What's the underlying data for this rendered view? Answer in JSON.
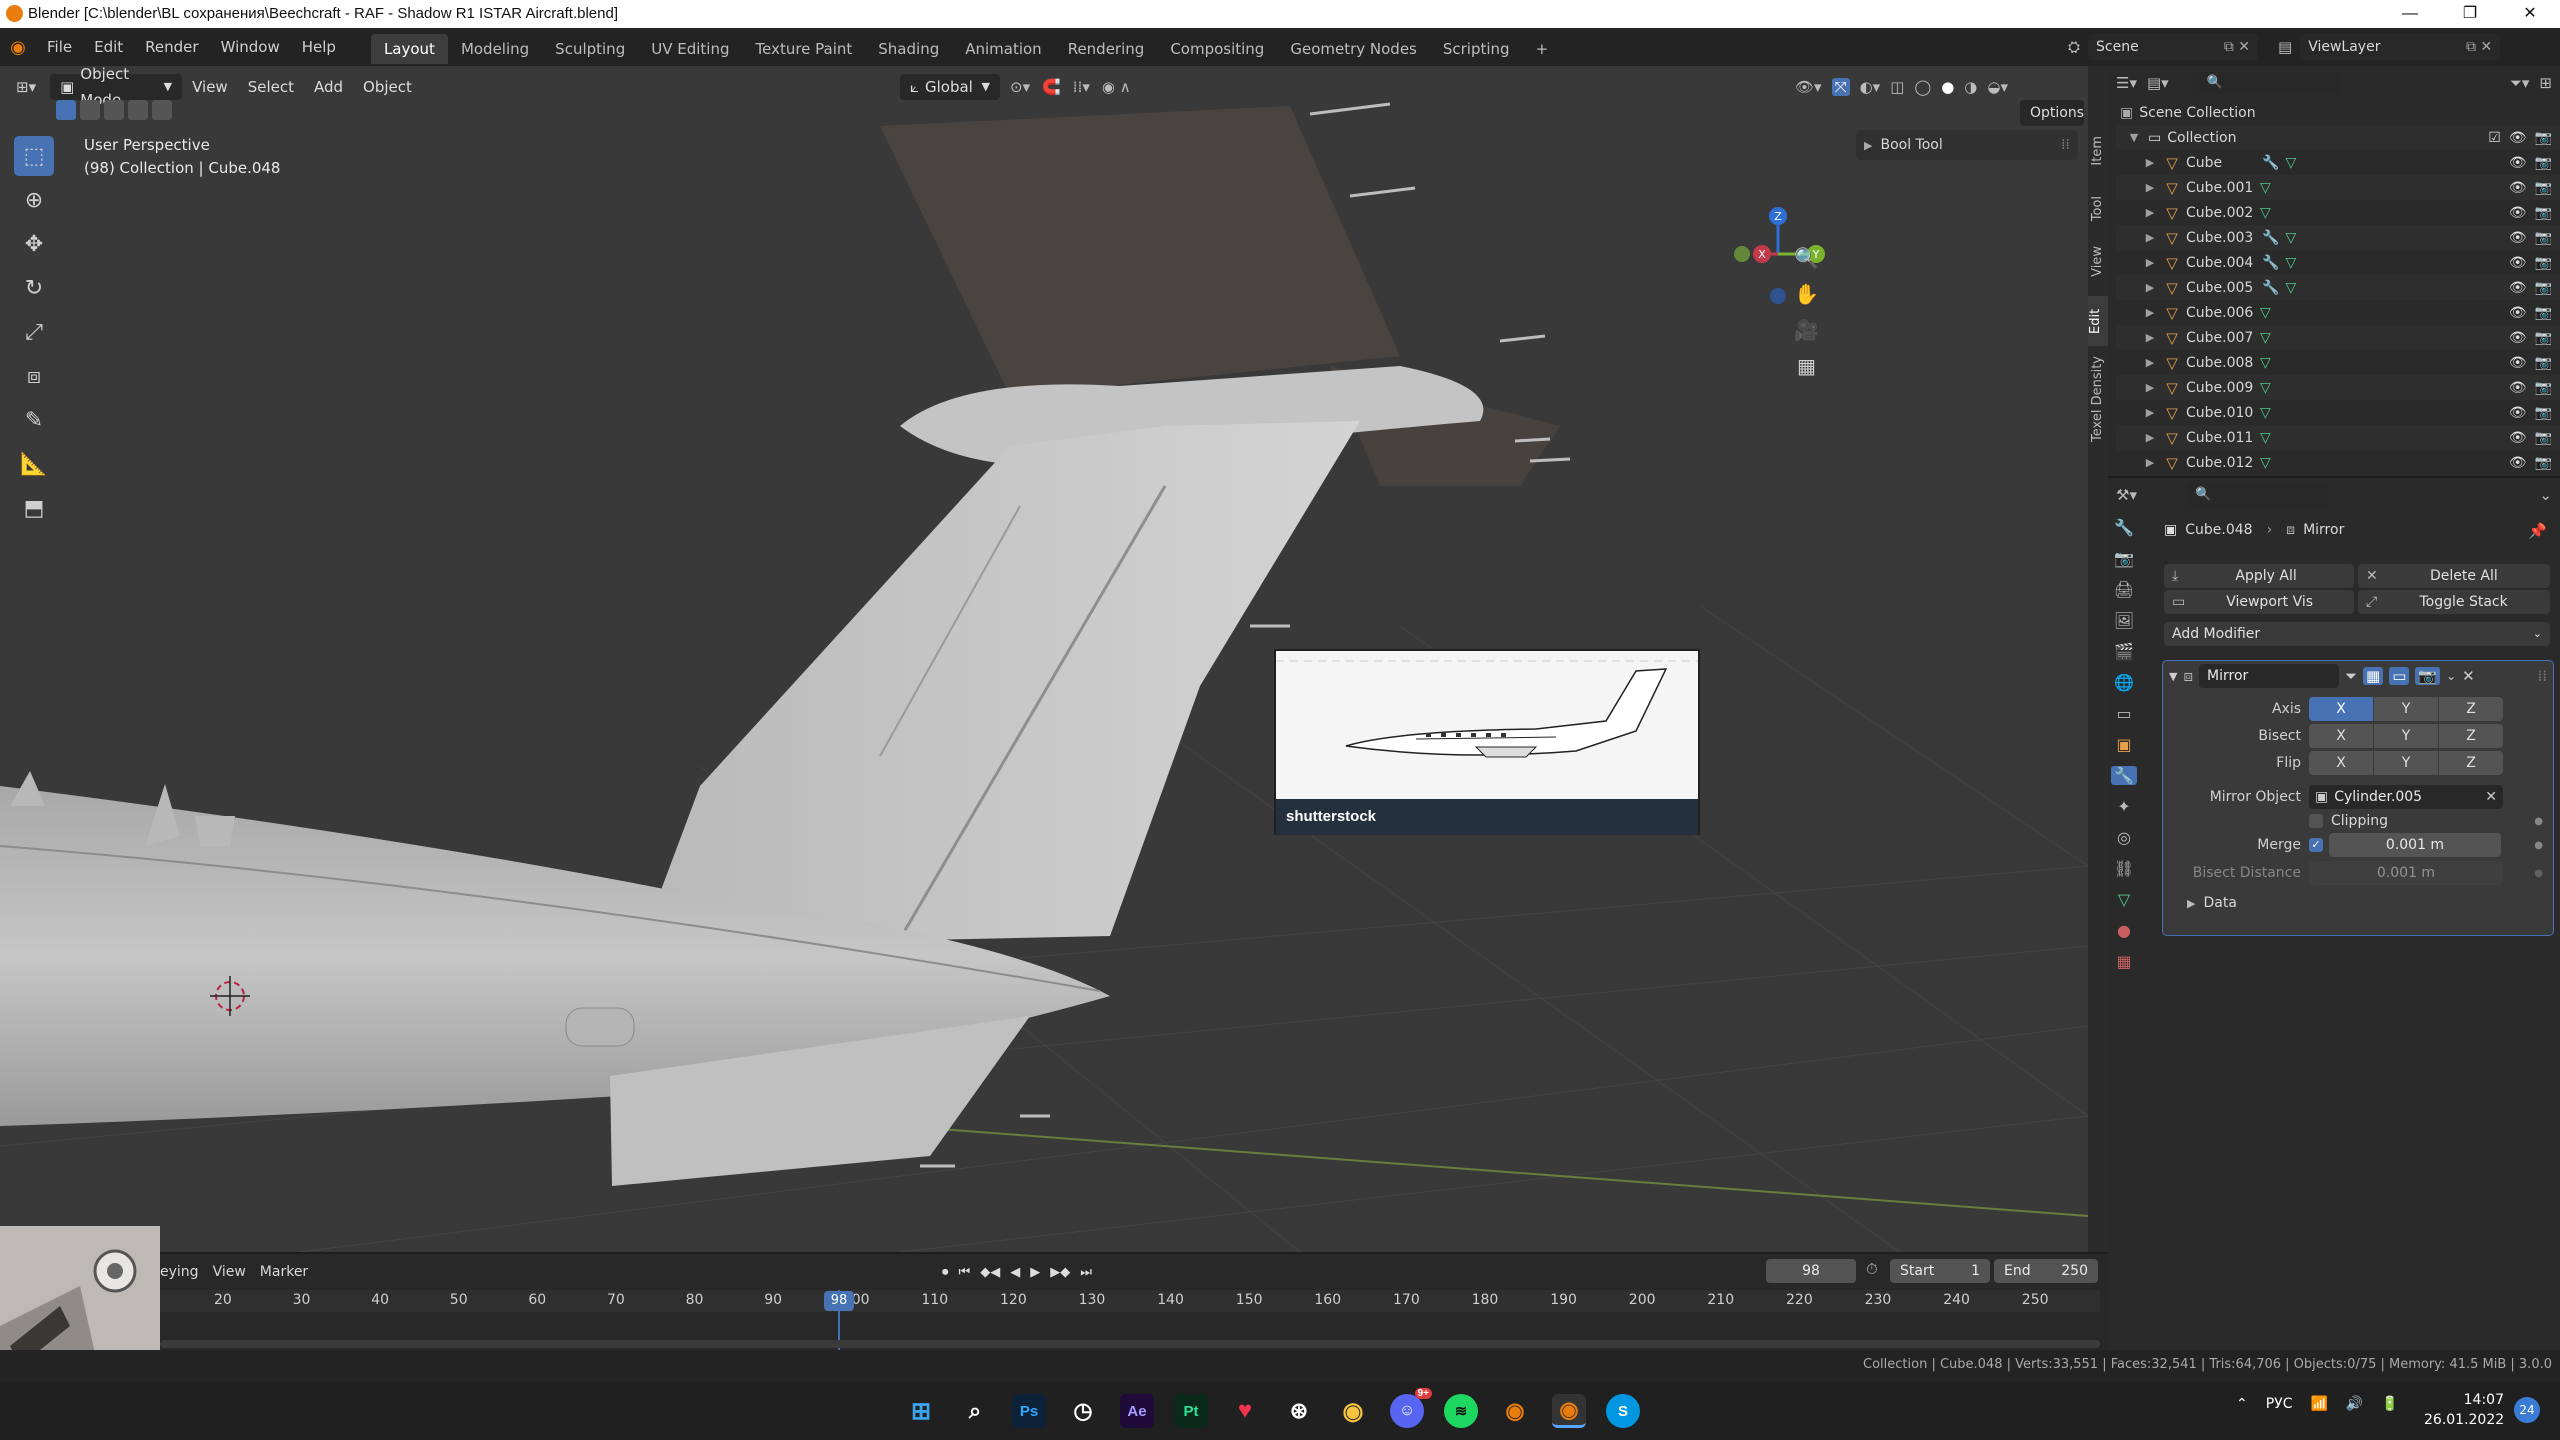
{
  "window": {
    "title": "Blender [C:\\blender\\BL сохранения\\Beechcraft - RAF - Shadow R1 ISTAR Aircraft.blend]",
    "controls": [
      "—",
      "❐",
      "✕"
    ]
  },
  "menubar": {
    "menus": [
      "File",
      "Edit",
      "Render",
      "Window",
      "Help"
    ],
    "workspaces": [
      "Layout",
      "Modeling",
      "Sculpting",
      "UV Editing",
      "Texture Paint",
      "Shading",
      "Animation",
      "Rendering",
      "Compositing",
      "Geometry Nodes",
      "Scripting"
    ],
    "active_workspace": "Layout",
    "add_tab": "+",
    "scene_label": "Scene",
    "viewlayer_label": "ViewLayer"
  },
  "viewport": {
    "mode": "Object Mode",
    "menus": [
      "View",
      "Select",
      "Add",
      "Object"
    ],
    "orientation": "Global",
    "options_label": "Options",
    "perspective": "User Perspective",
    "context": "(98) Collection | Cube.048",
    "side_panel_title": "Bool Tool",
    "side_tabs": [
      "Item",
      "Tool",
      "View",
      "Edit",
      "Texel Density"
    ],
    "gizmo_axes": {
      "x": "X",
      "y": "Y",
      "z": "Z"
    },
    "reference_brand": "shutterstock"
  },
  "outliner": {
    "root": "Scene Collection",
    "collection": "Collection",
    "items": [
      {
        "name": "Cube",
        "modifier": true
      },
      {
        "name": "Cube.001",
        "modifier": false
      },
      {
        "name": "Cube.002",
        "modifier": false
      },
      {
        "name": "Cube.003",
        "modifier": true
      },
      {
        "name": "Cube.004",
        "modifier": true
      },
      {
        "name": "Cube.005",
        "modifier": true
      },
      {
        "name": "Cube.006",
        "modifier": false
      },
      {
        "name": "Cube.007",
        "modifier": false
      },
      {
        "name": "Cube.008",
        "modifier": false
      },
      {
        "name": "Cube.009",
        "modifier": false
      },
      {
        "name": "Cube.010",
        "modifier": false
      },
      {
        "name": "Cube.011",
        "modifier": false
      },
      {
        "name": "Cube.012",
        "modifier": false
      }
    ]
  },
  "properties": {
    "breadcrumb_object": "Cube.048",
    "breadcrumb_modifier": "Mirror",
    "apply_all": "Apply All",
    "delete_all": "Delete All",
    "viewport_vis": "Viewport Vis",
    "toggle_stack": "Toggle Stack",
    "add_modifier": "Add Modifier",
    "modifier_name": "Mirror",
    "axis_label": "Axis",
    "bisect_label": "Bisect",
    "flip_label": "Flip",
    "x": "X",
    "y": "Y",
    "z": "Z",
    "mirror_object_label": "Mirror Object",
    "mirror_object_value": "Cylinder.005",
    "clipping_label": "Clipping",
    "merge_label": "Merge",
    "merge_value": "0.001 m",
    "bisect_distance_label": "Bisect Distance",
    "bisect_distance_value": "0.001 m",
    "data_label": "Data"
  },
  "timeline": {
    "menus": [
      "eying",
      "View",
      "Marker"
    ],
    "current_frame": "98",
    "start_label": "Start",
    "start_value": "1",
    "end_label": "End",
    "end_value": "250",
    "ticks": [
      "20",
      "30",
      "40",
      "50",
      "60",
      "70",
      "80",
      "90",
      "100",
      "110",
      "120",
      "130",
      "140",
      "150",
      "160",
      "170",
      "180",
      "190",
      "200",
      "210",
      "220",
      "230",
      "240",
      "250"
    ],
    "playhead_label": "98"
  },
  "status": {
    "text": "Collection | Cube.048 | Verts:33,551 | Faces:32,541 | Tris:64,706 | Objects:0/75 | Memory: 41.5 MiB | 3.0.0"
  },
  "taskbar": {
    "lang": "РУС",
    "time": "14:07",
    "date": "26.01.2022",
    "notif": "24",
    "discord_badge": "9+",
    "apps": [
      "Ps",
      "Ae",
      "Pt",
      "S"
    ]
  }
}
